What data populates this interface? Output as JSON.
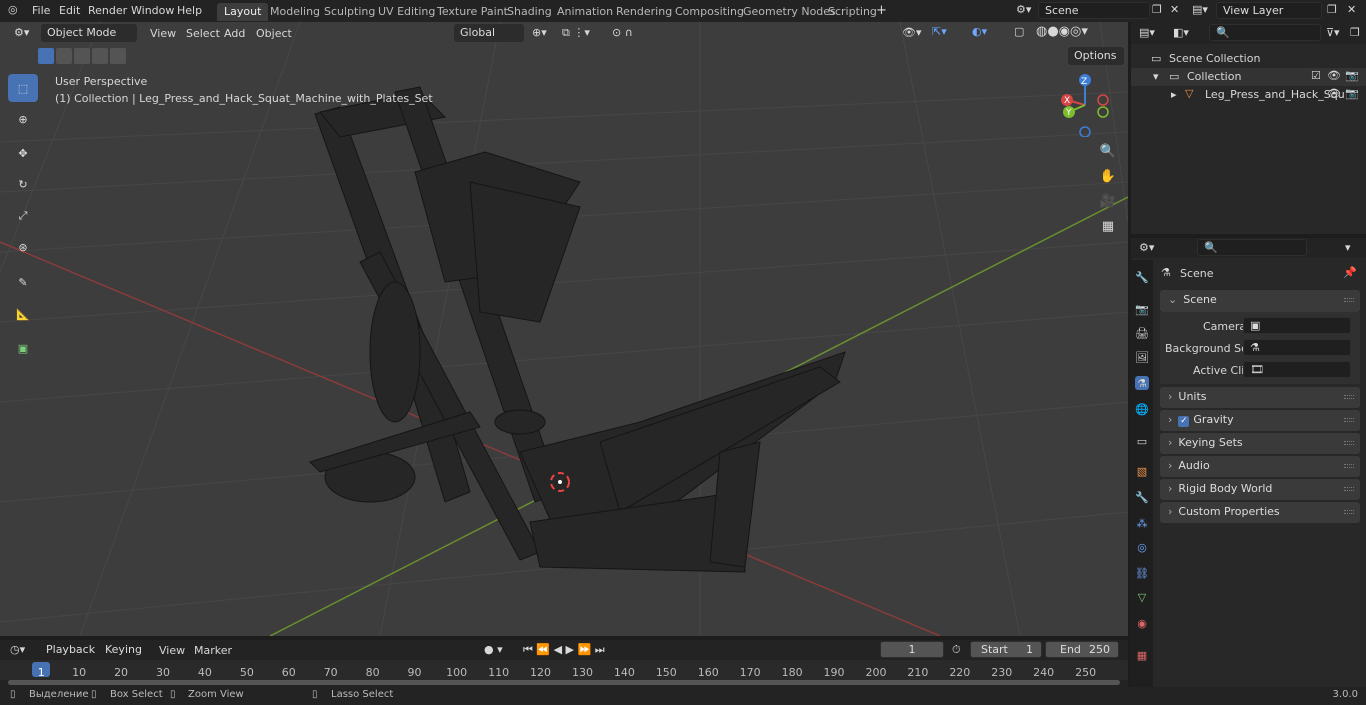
{
  "topbar": {
    "menus": [
      "File",
      "Edit",
      "Render",
      "Window",
      "Help"
    ],
    "workspaces": [
      "Layout",
      "Modeling",
      "Sculpting",
      "UV Editing",
      "Texture Paint",
      "Shading",
      "Animation",
      "Rendering",
      "Compositing",
      "Geometry Nodes",
      "Scripting"
    ],
    "active_workspace": "Layout",
    "add_tab": "+",
    "scene_name": "Scene",
    "view_layer": "View Layer"
  },
  "viewport_header": {
    "mode": "Object Mode",
    "menus": [
      "View",
      "Select",
      "Add",
      "Object"
    ],
    "transform_orientation": "Global",
    "options": "Options"
  },
  "viewport": {
    "perspective_label": "User Perspective",
    "collection_label": "(1) Collection | Leg_Press_and_Hack_Squat_Machine_with_Plates_Set",
    "gizmo_axes": [
      "X",
      "Y",
      "Z"
    ],
    "colors": {
      "x_axis": "#8a3b3b",
      "y_axis": "#6b8f2e",
      "grid": "#4a4a4a",
      "accent": "#4772b3"
    }
  },
  "outliner": {
    "root": "Scene Collection",
    "collection": "Collection",
    "object": "Leg_Press_and_Hack_Squ"
  },
  "properties": {
    "title": "Scene",
    "panel_scene": "Scene",
    "camera_label": "Camera",
    "background_label": "Background Sce...",
    "active_clip_label": "Active Clip",
    "panels": [
      "Units",
      "Gravity",
      "Keying Sets",
      "Audio",
      "Rigid Body World",
      "Custom Properties"
    ],
    "gravity_checked": true
  },
  "timeline": {
    "menus": [
      "Playback",
      "Keying",
      "View",
      "Marker"
    ],
    "current_frame": "1",
    "start_label": "Start",
    "start_value": "1",
    "end_label": "End",
    "end_value": "250",
    "frame_ticks": [
      "1",
      "10",
      "20",
      "30",
      "40",
      "50",
      "60",
      "70",
      "80",
      "90",
      "100",
      "110",
      "120",
      "130",
      "140",
      "150",
      "160",
      "170",
      "180",
      "190",
      "200",
      "210",
      "220",
      "230",
      "240",
      "250"
    ]
  },
  "statusbar": {
    "hint1": "Выделение",
    "hint2": "Box Select",
    "hint3": "Zoom View",
    "hint4": "Lasso Select",
    "version": "3.0.0"
  }
}
